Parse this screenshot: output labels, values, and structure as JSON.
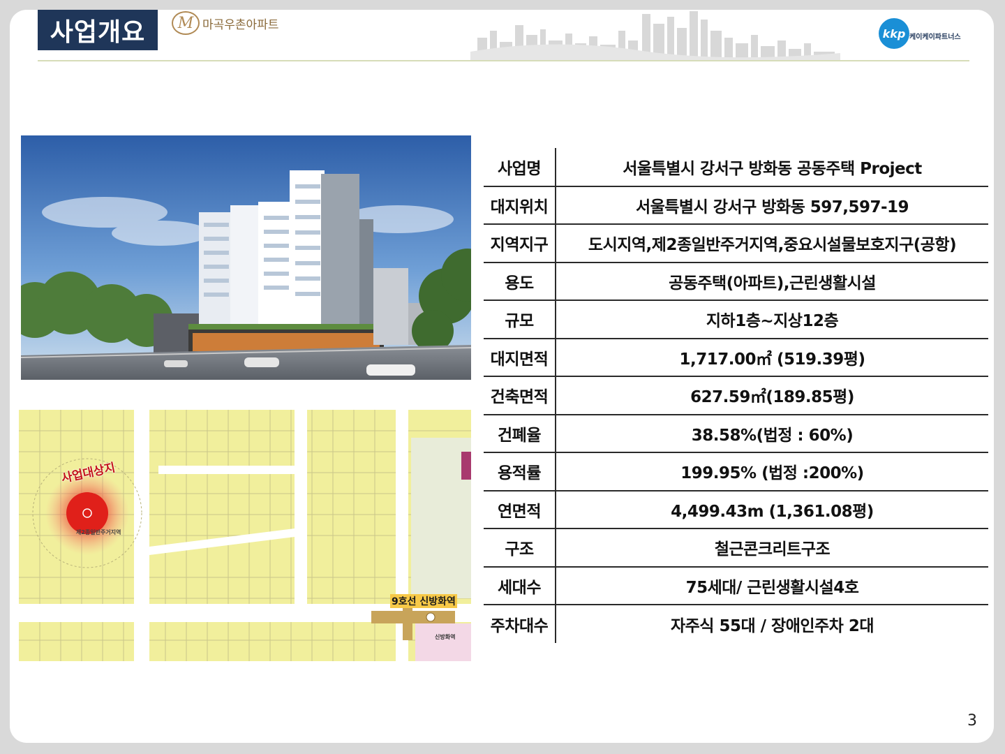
{
  "header": {
    "title": "사업개요",
    "brand_name": "마곡우촌아파트",
    "logo_mark": "kkp",
    "logo_company": "케이케이파트너스"
  },
  "map": {
    "site_label": "사업대상지",
    "station_label": "9호선 신방화역",
    "zone_text": "제2종일반주거지역",
    "station_small": "신방화역"
  },
  "table": {
    "rows": [
      {
        "key": "사업명",
        "value": "서울특별시 강서구 방화동 공동주택 Project"
      },
      {
        "key": "대지위치",
        "value": "서울특별시 강서구 방화동 597,597-19"
      },
      {
        "key": "지역지구",
        "value": "도시지역,제2종일반주거지역,중요시설물보호지구(공항)"
      },
      {
        "key": "용도",
        "value": "공동주택(아파트),근린생활시설"
      },
      {
        "key": "규모",
        "value": "지하1층~지상12층"
      },
      {
        "key": "대지면적",
        "value": "1,717.00㎡ (519.39평)"
      },
      {
        "key": "건축면적",
        "value": "627.59㎡(189.85평)"
      },
      {
        "key": "건폐율",
        "value": "38.58%(법정 : 60%)"
      },
      {
        "key": "용적률",
        "value": "199.95% (법정 :200%)"
      },
      {
        "key": "연면적",
        "value": "4,499.43m (1,361.08평)"
      },
      {
        "key": "구조",
        "value": "철근콘크리트구조"
      },
      {
        "key": "세대수",
        "value": "75세대/ 근린생활시설4호"
      },
      {
        "key": "주차대수",
        "value": "자주식 55대 / 장애인주차 2대"
      }
    ]
  },
  "footer": {
    "page_number": "3"
  },
  "colors": {
    "title_bg": "#1f3659",
    "brand": "#8a6a3a",
    "logo": "#1a8fd6",
    "map_bg": "#f1ef9c",
    "site_marker": "#e0201a"
  }
}
